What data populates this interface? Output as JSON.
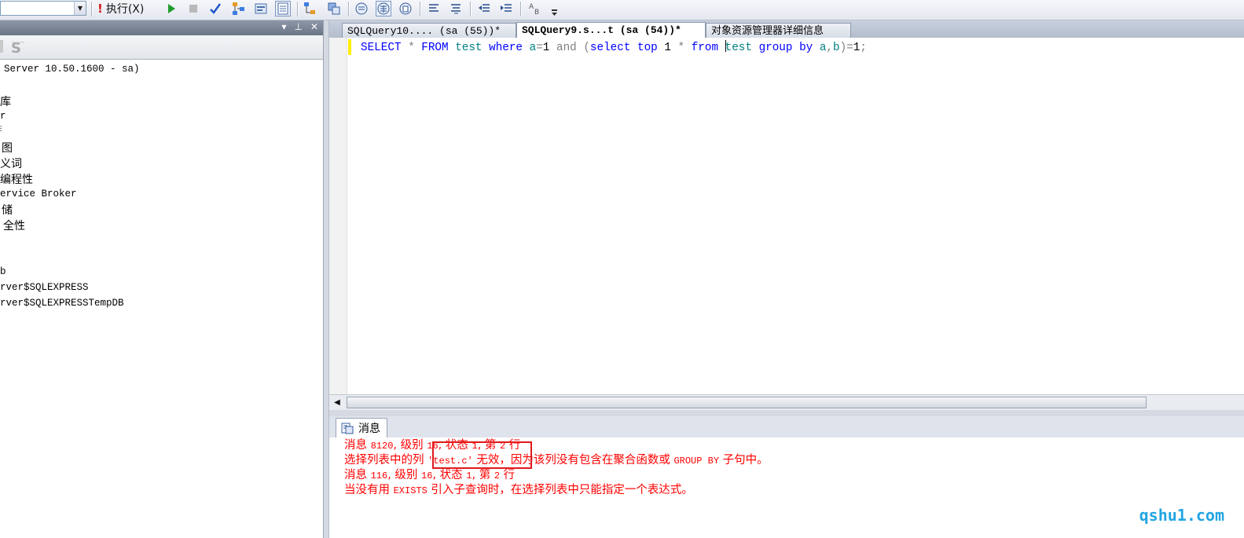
{
  "toolbar": {
    "execute_label": "执行(X)",
    "icons": [
      "database-combo",
      "execute-bang",
      "run-icon",
      "stop-icon",
      "parse-check-icon",
      "estimated-plan-icon",
      "query-options-icon",
      "results-to-grid-icon",
      "include-plan-icon",
      "client-stats-icon",
      "results-text-icon",
      "results-grid-icon",
      "results-file-icon",
      "comment-icon",
      "uncomment-icon",
      "outdent-icon",
      "indent-icon",
      "specify-values-icon"
    ]
  },
  "object_explorer": {
    "header_icons": [
      "pin-dropdown-icon",
      "pin-icon",
      "close-icon"
    ],
    "tree": [
      {
        "label": "Server 10.50.1600 - sa)"
      },
      {
        "label": "库"
      },
      {
        "label": "r"
      },
      {
        "label": "E"
      },
      {
        "label": "图"
      },
      {
        "label": "义词"
      },
      {
        "label": "编程性"
      },
      {
        "label": "ervice Broker"
      },
      {
        "label": "储"
      },
      {
        "label": "全性"
      },
      {
        "label": "b"
      },
      {
        "label": "rver$SQLEXPRESS"
      },
      {
        "label": "rver$SQLEXPRESSTempDB"
      }
    ]
  },
  "tabs": [
    {
      "label": "SQLQuery10.... (sa (55))*",
      "active": false
    },
    {
      "label": "SQLQuery9.s...t (sa (54))*",
      "active": true
    },
    {
      "label": "对象资源管理器详细信息",
      "active": false
    }
  ],
  "editor": {
    "tokens": [
      {
        "t": "SELECT",
        "c": "kw"
      },
      {
        "t": " ",
        "c": "txt"
      },
      {
        "t": "*",
        "c": "op"
      },
      {
        "t": " ",
        "c": "txt"
      },
      {
        "t": "FROM",
        "c": "kw"
      },
      {
        "t": " ",
        "c": "txt"
      },
      {
        "t": "test",
        "c": "ident"
      },
      {
        "t": " ",
        "c": "txt"
      },
      {
        "t": "where",
        "c": "kw"
      },
      {
        "t": " ",
        "c": "txt"
      },
      {
        "t": "a",
        "c": "ident"
      },
      {
        "t": "=",
        "c": "op"
      },
      {
        "t": "1",
        "c": "txt"
      },
      {
        "t": " ",
        "c": "txt"
      },
      {
        "t": "and",
        "c": "op"
      },
      {
        "t": " ",
        "c": "txt"
      },
      {
        "t": "(",
        "c": "op"
      },
      {
        "t": "select",
        "c": "kw"
      },
      {
        "t": " ",
        "c": "txt"
      },
      {
        "t": "top",
        "c": "kw"
      },
      {
        "t": " ",
        "c": "txt"
      },
      {
        "t": "1",
        "c": "txt"
      },
      {
        "t": " ",
        "c": "txt"
      },
      {
        "t": "*",
        "c": "op"
      },
      {
        "t": " ",
        "c": "txt"
      },
      {
        "t": "from",
        "c": "kw"
      },
      {
        "t": " ",
        "c": "txt"
      },
      {
        "t": "CARET",
        "c": "caret"
      },
      {
        "t": "test",
        "c": "ident"
      },
      {
        "t": " ",
        "c": "txt"
      },
      {
        "t": "group",
        "c": "kw"
      },
      {
        "t": " ",
        "c": "txt"
      },
      {
        "t": "by",
        "c": "kw"
      },
      {
        "t": " ",
        "c": "txt"
      },
      {
        "t": "a",
        "c": "ident"
      },
      {
        "t": ",",
        "c": "op"
      },
      {
        "t": "b",
        "c": "ident"
      },
      {
        "t": ")",
        "c": "op"
      },
      {
        "t": "=",
        "c": "op"
      },
      {
        "t": "1",
        "c": "txt"
      },
      {
        "t": ";",
        "c": "op"
      }
    ]
  },
  "results": {
    "messages_tab_label": "消息",
    "messages": [
      {
        "parts": [
          {
            "t": "消息 ",
            "m": false
          },
          {
            "t": "8120",
            "m": true
          },
          {
            "t": ", 级别 ",
            "m": false
          },
          {
            "t": "16",
            "m": true
          },
          {
            "t": ", 状态 ",
            "m": false
          },
          {
            "t": "1",
            "m": true
          },
          {
            "t": ", 第 ",
            "m": false
          },
          {
            "t": "2",
            "m": true
          },
          {
            "t": " 行",
            "m": false
          }
        ]
      },
      {
        "parts": [
          {
            "t": "选择列表中的列 ",
            "m": false
          },
          {
            "t": "'test.c'",
            "m": true
          },
          {
            "t": " 无效，因为该列没有包含在聚合函数或 ",
            "m": false
          },
          {
            "t": "GROUP BY",
            "m": true
          },
          {
            "t": " 子句中。",
            "m": false
          }
        ]
      },
      {
        "parts": [
          {
            "t": "消息 ",
            "m": false
          },
          {
            "t": "116",
            "m": true
          },
          {
            "t": ", 级别 ",
            "m": false
          },
          {
            "t": "16",
            "m": true
          },
          {
            "t": ", 状态 ",
            "m": false
          },
          {
            "t": "1",
            "m": true
          },
          {
            "t": ", 第 ",
            "m": false
          },
          {
            "t": "2",
            "m": true
          },
          {
            "t": " 行",
            "m": false
          }
        ]
      },
      {
        "parts": [
          {
            "t": "当没有用 ",
            "m": false
          },
          {
            "t": "EXISTS",
            "m": true
          },
          {
            "t": " 引入子查询时，在选择列表中只能指定一个表达式。",
            "m": false
          }
        ]
      }
    ]
  },
  "watermark": "qshu1.com",
  "colors": {
    "keyword": "#0000ff",
    "identifier": "#008080",
    "operator": "#808080",
    "error": "#ff0000",
    "highlight_box": "#e0191c"
  }
}
